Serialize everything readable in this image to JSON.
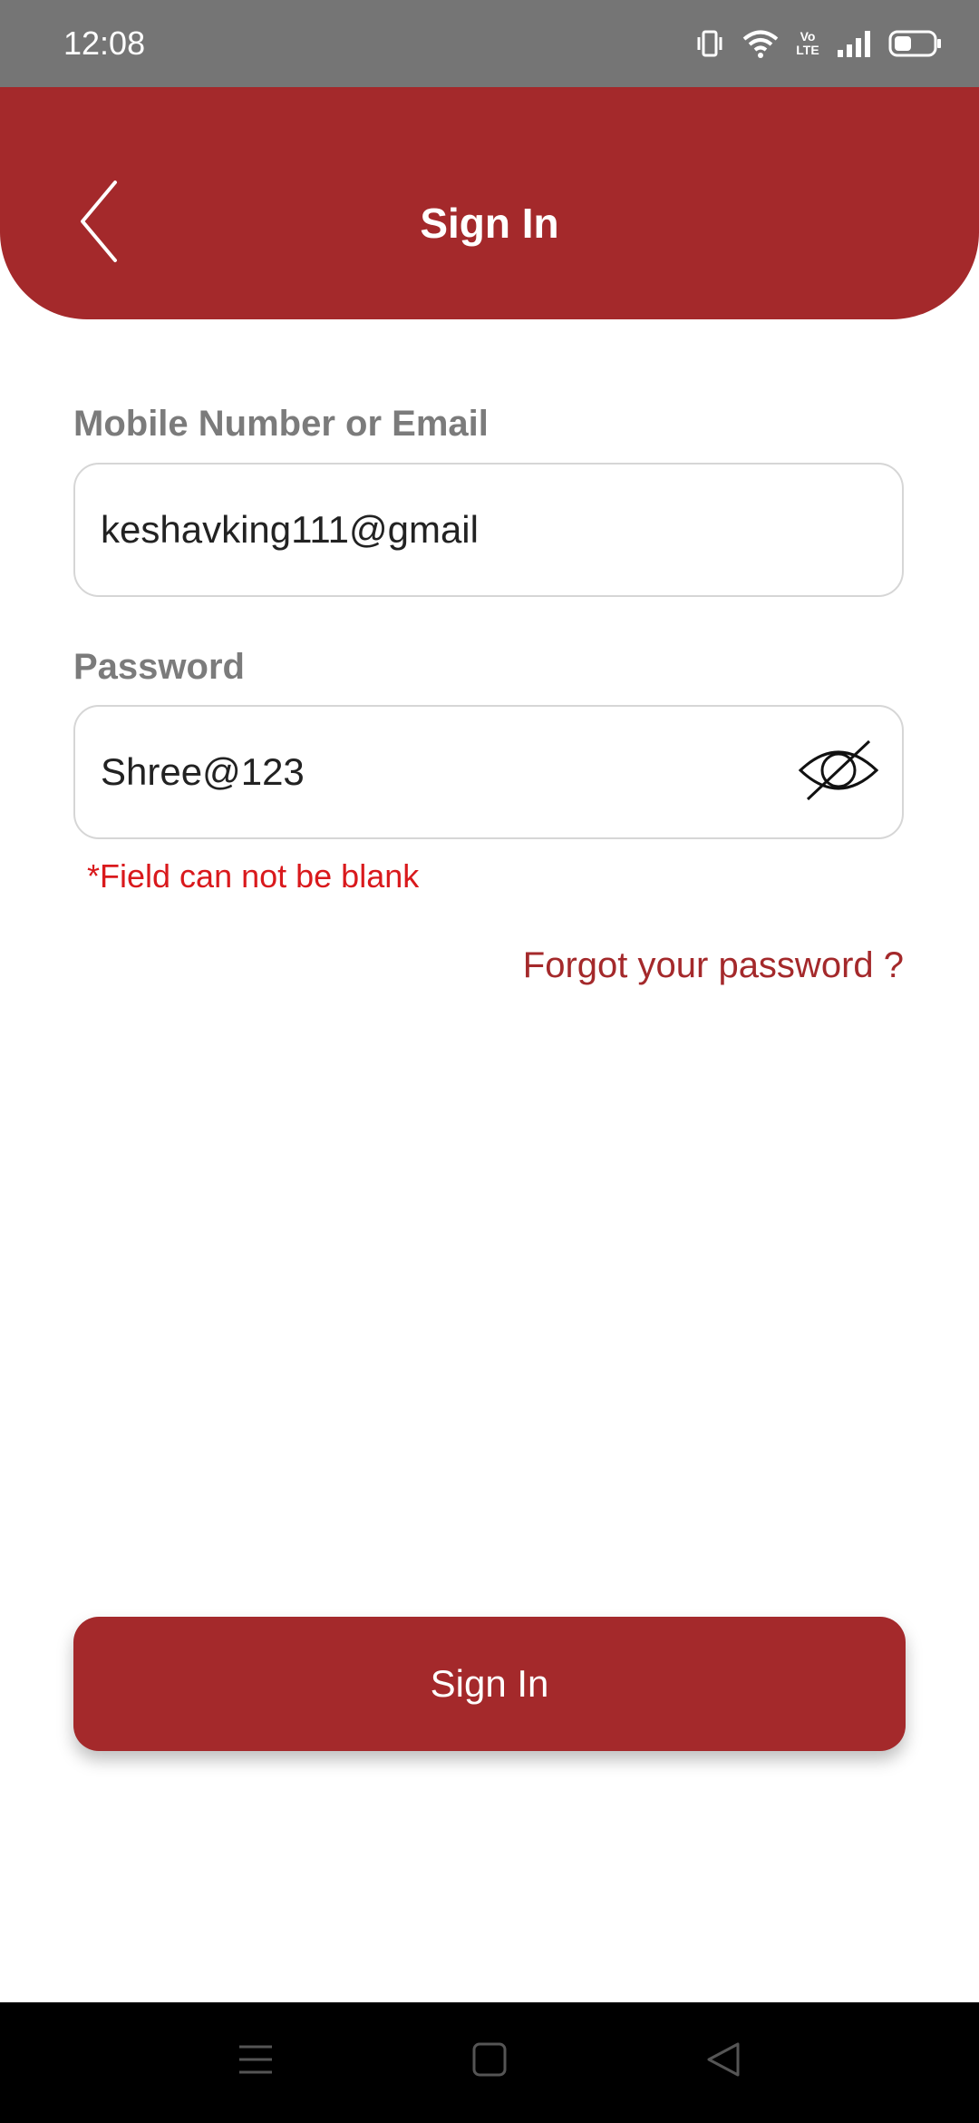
{
  "status_bar": {
    "time": "12:08",
    "icons": [
      "vibrate-icon",
      "wifi-icon",
      "volte-icon",
      "signal-icon",
      "battery-icon"
    ],
    "volte_label": "Vo LTE",
    "battery_level": 0.45
  },
  "header": {
    "title": "Sign In",
    "back_icon": "chevron-left-icon",
    "background_color": "#a4292b"
  },
  "form": {
    "email_label": "Mobile Number or Email",
    "email_value": "keshavking111@gmail",
    "password_label": "Password",
    "password_value": "Shree@123",
    "password_toggle_icon": "eye-off-icon",
    "error_message": "*Field can not be blank",
    "forgot_link": "Forgot your password ?"
  },
  "actions": {
    "sign_in_label": "Sign In"
  },
  "nav_bar": {
    "icons": [
      "menu-icon",
      "home-icon",
      "back-triangle-icon"
    ]
  },
  "colors": {
    "accent": "#a4292b",
    "error": "#d9191c",
    "label": "#7b7b7b"
  }
}
